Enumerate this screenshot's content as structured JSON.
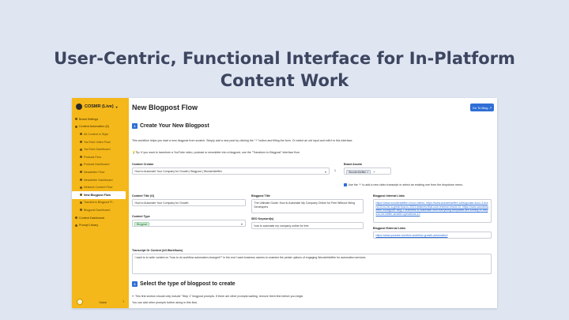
{
  "headline": {
    "line1": "User-Centric, Functional Interface for In-Platform",
    "line2": "Content Work"
  },
  "sidebar": {
    "brand": "COSMR (Live)",
    "items": [
      {
        "label": "Brand Settings",
        "sub": false,
        "active": false
      },
      {
        "label": "Content Automation (6)",
        "sub": false,
        "active": false
      },
      {
        "label": "All Content in Style",
        "sub": true,
        "active": false
      },
      {
        "label": "YouTube Video Flow",
        "sub": true,
        "active": false
      },
      {
        "label": "YouTube Dashboard",
        "sub": true,
        "active": false
      },
      {
        "label": "Podcast Flow",
        "sub": true,
        "active": false
      },
      {
        "label": "Podcast Dashboard",
        "sub": true,
        "active": false
      },
      {
        "label": "Newsletter Flow",
        "sub": true,
        "active": false
      },
      {
        "label": "Newsletter Dashboard",
        "sub": true,
        "active": false
      },
      {
        "label": "Network Content Flow",
        "sub": true,
        "active": false
      },
      {
        "label": "New Blogpost Flow",
        "sub": true,
        "active": true
      },
      {
        "label": "Transform Blogpost Fl...",
        "sub": true,
        "active": false
      },
      {
        "label": "Blogpost Dashboard",
        "sub": true,
        "active": false
      },
      {
        "label": "Content Dashboard",
        "sub": false,
        "active": false
      },
      {
        "label": "Prompt Library",
        "sub": false,
        "active": false
      }
    ],
    "footer_label": "Voice"
  },
  "main": {
    "title": "New Blogpost Flow",
    "go_button": "Go To Blog",
    "section1": {
      "number": "1",
      "title": "Create Your New Blogpost",
      "intro": "This workflow helps you start a new blogpost from scratch. Simply add a new post by clicking the \"+\" button and filling the form. Or select an old input and edit it in this interface.",
      "tip": "Tip: If you want to transform a YouTube video, podcast or newsletter into a blogpost, use the \"Transform to Blogpost\" interface flow."
    },
    "content_creator": {
      "label": "Content Creator",
      "value": "How to Automate Your Company for Growth | Blogpost | WunderlAeffen",
      "count": "1"
    },
    "brand_assets": {
      "label": "Brand Assets",
      "tag": "WunderlAeffen",
      "hint": "Use the '+' to add a new video transcript or select an existing one from the dropdown menu."
    },
    "content_title": {
      "label": "Content Title (G)",
      "value": "How to Automate Your Company for Growth"
    },
    "blogpost_title": {
      "label": "Blogpost Title",
      "value": "The Ultimate Guide: How to Automate My Company Online for Free Without Hiring Developers"
    },
    "internal_links": {
      "label": "Blogpost Internal Links",
      "value": "https://www.wunderlaeffen.io/our-clients; https://www.wunderlaeffen.io/blog/case-koco-3-brand-2x-to-be-a-great-how-to-2023-features-that-root-revenue-result-10; https://www.wunderlaeffen.io/blog/our-blog-1-business-to-automate-with-everything-templates-are-turning-AI-ways-to-be-better-smaller-operations-10"
    },
    "content_type": {
      "label": "Content Type",
      "value": "Blogpost"
    },
    "seo_keywords": {
      "label": "SEO Keyword(s)",
      "value": "how to automate my company online for free"
    },
    "external_links": {
      "label": "Blogpost External Links",
      "value": "https://www.youtube.com/live-workflow-growth-automation/"
    },
    "transcript": {
      "label": "Transcript Or Context (All Workflows)",
      "value": "I want to to write content on \"how to do workflow automation changed?\" In the end I want business owners to examine the pester options of engaging WunderlAeffen for automation services."
    },
    "section2": {
      "number": "2",
      "title": "Select the type of blogpost to create",
      "line1": "This first section should only include \"Step 1\" blogpost prompts. If there are other prompts waiting, remove them first before you begin.",
      "line2": "You can add other prompts further along in this flow."
    }
  }
}
